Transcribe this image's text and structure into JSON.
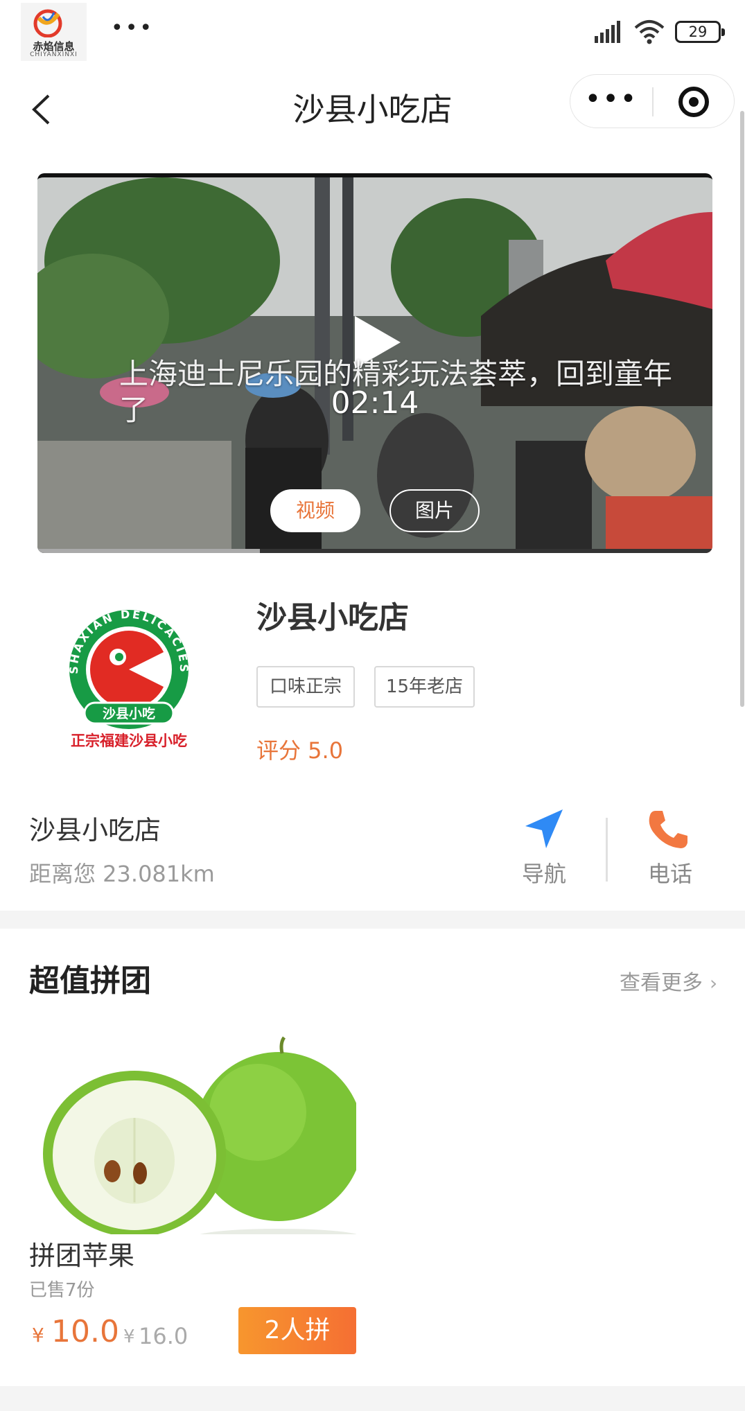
{
  "status_bar": {
    "app_logo_name": "赤焰信息",
    "app_logo_sub": "CHIYANXINXI",
    "dots": "•••",
    "battery": "29",
    "icons": [
      "signal-icon",
      "wifi-icon",
      "battery-icon"
    ]
  },
  "nav": {
    "title": "沙县小吃店",
    "more": "•••",
    "icons": [
      "back-icon",
      "more-icon",
      "target-icon"
    ]
  },
  "video": {
    "caption": "上海迪士尼乐园的精彩玩法荟萃，回到童年了",
    "duration": "02:14",
    "progress": 0.33,
    "tabs": {
      "video": "视频",
      "image": "图片"
    },
    "icons": [
      "play-icon"
    ]
  },
  "store": {
    "name": "沙县小吃店",
    "tags": [
      "口味正宗",
      "15年老店"
    ],
    "rating": "评分 5.0",
    "logo_text_top": "SHAXIAN DELICACIES",
    "logo_text_band": "沙县小吃",
    "logo_text_bottom": "正宗福建沙县小吃"
  },
  "location": {
    "name": "沙县小吃店",
    "distance": "距离您 23.081km",
    "nav_label": "导航",
    "call_label": "电话",
    "icons": [
      "navigation-icon",
      "phone-icon"
    ]
  },
  "group_buy": {
    "title": "超值拼团",
    "see_more": "查看更多",
    "chevron": "›",
    "product": {
      "name": "拼团苹果",
      "sold": "已售7份",
      "currency": "¥",
      "price": "10.0",
      "orig_currency": "¥",
      "orig_price": "16.0",
      "button": "2人拼"
    }
  },
  "colors": {
    "accent": "#e8753a",
    "button_start": "#f7962e",
    "button_end": "#f56f33",
    "nav_blue": "#2f8af5"
  }
}
